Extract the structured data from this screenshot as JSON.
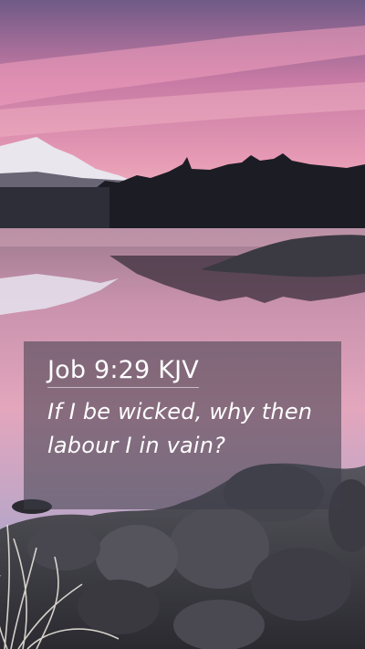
{
  "wallpaper": {
    "scene": "sunset-lake-landscape"
  },
  "verse": {
    "reference": "Job 9:29 KJV",
    "text": "If I be wicked, why then labour I in vain?"
  },
  "colors": {
    "sky_top": "#6f5a86",
    "sky_mid": "#e38aa8",
    "sky_horizon": "#f3c4c7",
    "water": "#d4a0b7",
    "card_background": "rgba(60,60,72,0.55)",
    "text": "#ffffff"
  }
}
